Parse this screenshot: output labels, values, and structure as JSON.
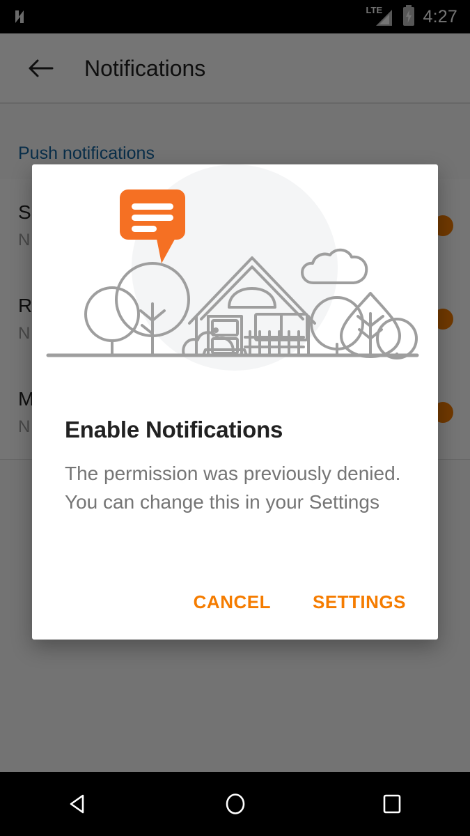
{
  "statusbar": {
    "logo_icon": "android-n-logo-icon",
    "network_label": "LTE",
    "network_icon": "signal-bars-icon",
    "battery_icon": "battery-charging-icon",
    "clock": "4:27"
  },
  "appbar": {
    "back_icon": "arrow-back-icon",
    "title": "Notifications"
  },
  "content": {
    "section_header": "Push notifications",
    "rows": [
      {
        "title": "S",
        "subtitle": "N",
        "switch_state": "on"
      },
      {
        "title": "R",
        "subtitle": "N",
        "switch_state": "on"
      },
      {
        "title": "M",
        "subtitle": "N",
        "switch_state": "on"
      }
    ]
  },
  "dialog": {
    "illustration_name": "house-with-message-bubble-illustration",
    "bubble_icon": "message-bubble-icon",
    "title": "Enable Notifications",
    "body": "The permission was previously denied. You can change this in your Settings",
    "cancel_label": "CANCEL",
    "settings_label": "SETTINGS"
  },
  "navbar": {
    "back_icon": "nav-back-triangle-icon",
    "home_icon": "nav-home-circle-icon",
    "recents_icon": "nav-recents-square-icon"
  },
  "colors": {
    "accent_orange": "#f57c00",
    "bubble_orange": "#f57023",
    "section_blue": "#1565a0",
    "title_dark": "#212121",
    "body_gray": "#757575",
    "illustration_gray": "#9e9e9e",
    "scrim": "rgba(0,0,0,0.54)"
  }
}
